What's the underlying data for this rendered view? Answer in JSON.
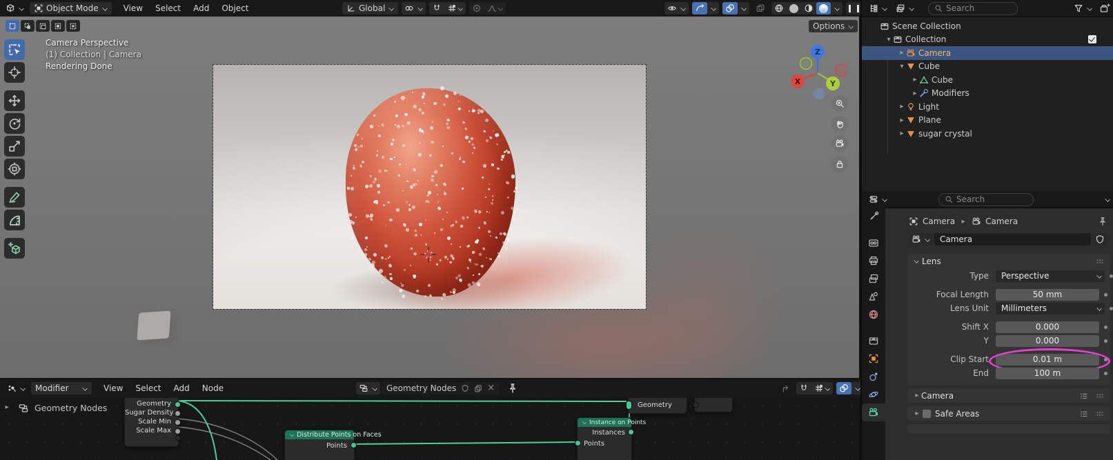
{
  "colors": {
    "accent_blue": "#4772b3",
    "selection_blue": "#3a5680",
    "node_header_green": "#1e7258",
    "wire_green": "#4ecf9d",
    "active_object_orange": "#ffb26b",
    "annotation_magenta": "#e93fd6",
    "candy_red": "#c0392b"
  },
  "icon_glyphs": {
    "search-icon": "magnifier",
    "filter-icon": "funnel",
    "snap-icon": "magnet",
    "pause-icon": "double-bar",
    "pin-icon": "pushpin",
    "fake-user-icon": "shield",
    "visibility-icon": "eye",
    "render-visibility-icon": "photo-camera"
  },
  "viewport_header": {
    "mode_label": "Object Mode",
    "menus": [
      "View",
      "Select",
      "Add",
      "Object"
    ],
    "orientation_label": "Global"
  },
  "tool_settings": {
    "options_label": "Options"
  },
  "viewport_overlay": {
    "line1": "Camera Perspective",
    "line2": "(1) Collection | Camera",
    "line3": "Rendering Done"
  },
  "gizmo": {
    "x": "X",
    "y": "Y",
    "z": "Z"
  },
  "outliner": {
    "search_placeholder": "Search",
    "rows": [
      {
        "label": "Scene Collection",
        "icon": "collection",
        "color": "#d0d0d0",
        "depth": 0,
        "arrow": "none",
        "extras": [],
        "right": []
      },
      {
        "label": "Collection",
        "icon": "collection",
        "color": "#d0d0d0",
        "depth": 1,
        "arrow": "down",
        "extras": [],
        "right": [
          "checkbox",
          "eye",
          "camera"
        ]
      },
      {
        "label": "Camera",
        "icon": "videocam",
        "color": "#e8934d",
        "depth": 2,
        "arrow": "right",
        "selected": true,
        "active": true,
        "extras": [
          [
            "videocam",
            "#5fd6b0"
          ]
        ],
        "right": [
          "eye",
          "camera"
        ]
      },
      {
        "label": "Cube",
        "icon": "meshobj",
        "color": "#e8934d",
        "depth": 2,
        "arrow": "down",
        "extras": [],
        "right": [
          "eye",
          "camera"
        ]
      },
      {
        "label": "Cube",
        "icon": "meshdata",
        "color": "#6fd49e",
        "depth": 3,
        "arrow": "right",
        "extras": [
          [
            "material",
            "#c96a6a"
          ]
        ],
        "right": []
      },
      {
        "label": "Modifiers",
        "icon": "wrench",
        "color": "#7a9ee8",
        "depth": 3,
        "arrow": "right",
        "extras": [
          [
            "subsurf",
            "#9fb6d8"
          ],
          [
            "particles",
            "#7a9ee8"
          ]
        ],
        "right": []
      },
      {
        "label": "Light",
        "icon": "bulb",
        "color": "#e8934d",
        "depth": 2,
        "arrow": "right",
        "extras": [
          [
            "bulbdata",
            "#7ed98c"
          ]
        ],
        "right": [
          "eye",
          "camera"
        ]
      },
      {
        "label": "Plane",
        "icon": "meshobj",
        "color": "#e8934d",
        "depth": 2,
        "arrow": "right",
        "extras": [
          [
            "meshdata",
            "#6fd49e"
          ]
        ],
        "right": [
          "eye",
          "camera"
        ]
      },
      {
        "label": "sugar crystal",
        "icon": "meshobj",
        "color": "#e8934d",
        "depth": 2,
        "arrow": "right",
        "extras": [
          [
            "wrench",
            "#7a9ee8"
          ],
          [
            "meshdata",
            "#6fd49e"
          ]
        ],
        "right": [
          "eye",
          "camera"
        ]
      }
    ]
  },
  "properties": {
    "search_placeholder": "Search",
    "breadcrumb": {
      "object": "Camera",
      "data": "Camera"
    },
    "name_field": "Camera",
    "tabs": [
      "tool",
      "render",
      "output",
      "viewlayer",
      "scene",
      "world",
      "collection",
      "object",
      "constraint",
      "physics",
      "camdata"
    ],
    "active_tab": "camdata",
    "lens": {
      "title": "Lens",
      "rows": [
        {
          "label": "Type",
          "value": "Perspective",
          "widget": "dropdown",
          "group_start": false
        },
        {
          "label": "Focal Length",
          "value": "50 mm",
          "widget": "number",
          "group_start": true
        },
        {
          "label": "Lens Unit",
          "value": "Millimeters",
          "widget": "dropdown",
          "group_start": false
        },
        {
          "label": "Shift X",
          "value": "0.000",
          "widget": "number",
          "group_start": true
        },
        {
          "label": "Y",
          "value": "0.000",
          "widget": "number",
          "group_start": false
        },
        {
          "label": "Clip Start",
          "value": "0.01 m",
          "widget": "number",
          "group_start": true,
          "highlighted": true
        },
        {
          "label": "End",
          "value": "100 m",
          "widget": "number",
          "group_start": false
        }
      ]
    },
    "collapsed_sections": [
      {
        "title": "Camera",
        "checkbox": false
      },
      {
        "title": "Safe Areas",
        "checkbox": true
      }
    ]
  },
  "node_editor": {
    "mode_label": "Modifier",
    "menus": [
      "View",
      "Select",
      "Add",
      "Node"
    ],
    "datablock_name": "Geometry Nodes",
    "breadcrumb": "Geometry Nodes",
    "nodes": {
      "group_input": {
        "sockets": [
          {
            "label": "Geometry",
            "type": "geometry"
          },
          {
            "label": "Sugar Density",
            "type": "value"
          },
          {
            "label": "Scale Min",
            "type": "value"
          },
          {
            "label": "Scale Max",
            "type": "value"
          }
        ]
      },
      "distribute_points": {
        "title": "Distribute Points on Faces",
        "output": "Points"
      },
      "instance_on_points": {
        "title": "Instance on Points",
        "output": "Instances",
        "input": "Points"
      },
      "group_output": {
        "input": "Geometry"
      }
    }
  }
}
